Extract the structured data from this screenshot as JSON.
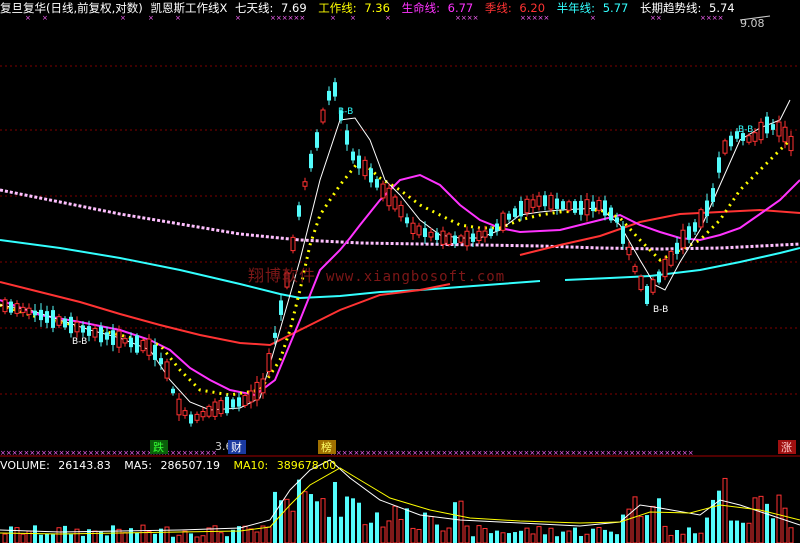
{
  "header": {
    "title": "复旦复华(日线,前复权,对数)",
    "indicator": "凯恩斯工作线X",
    "items": [
      {
        "label": "七天线: ",
        "value": "7.69",
        "color": "#ffffff"
      },
      {
        "label": "工作线: ",
        "value": "7.36",
        "color": "#ffff00"
      },
      {
        "label": "生命线: ",
        "value": "6.77",
        "color": "#ff33ff"
      },
      {
        "label": "季线: ",
        "value": "6.20",
        "color": "#ff3333"
      },
      {
        "label": "半年线: ",
        "value": "5.77",
        "color": "#33ffff"
      },
      {
        "label": "长期趋势线: ",
        "value": "5.74",
        "color": "#ffffff"
      }
    ]
  },
  "price_labels": {
    "high": "9.08",
    "low": "3.60"
  },
  "chart_tags": {
    "bb_up": "B-B",
    "bb_low": "B-B",
    "bb_right": "B-B",
    "bb_top": "B-B",
    "bb_left": "B-B",
    "bb_far": "B-B"
  },
  "badges": {
    "die": "跌",
    "cai": "财",
    "bang": "榜",
    "zhang": "涨"
  },
  "volume_header": {
    "volume": {
      "label": "VOLUME: ",
      "value": "26143.83"
    },
    "ma5": {
      "label": "MA5: ",
      "value": "286507.19"
    },
    "ma10": {
      "label": "MA10: ",
      "value": "389678.00"
    }
  },
  "watermark": {
    "text": "翔博软件",
    "url": "www.xiangbosoft.com"
  },
  "colors": {
    "up": "#ff3232",
    "down": "#54fcfc",
    "grid": "#800000"
  }
}
